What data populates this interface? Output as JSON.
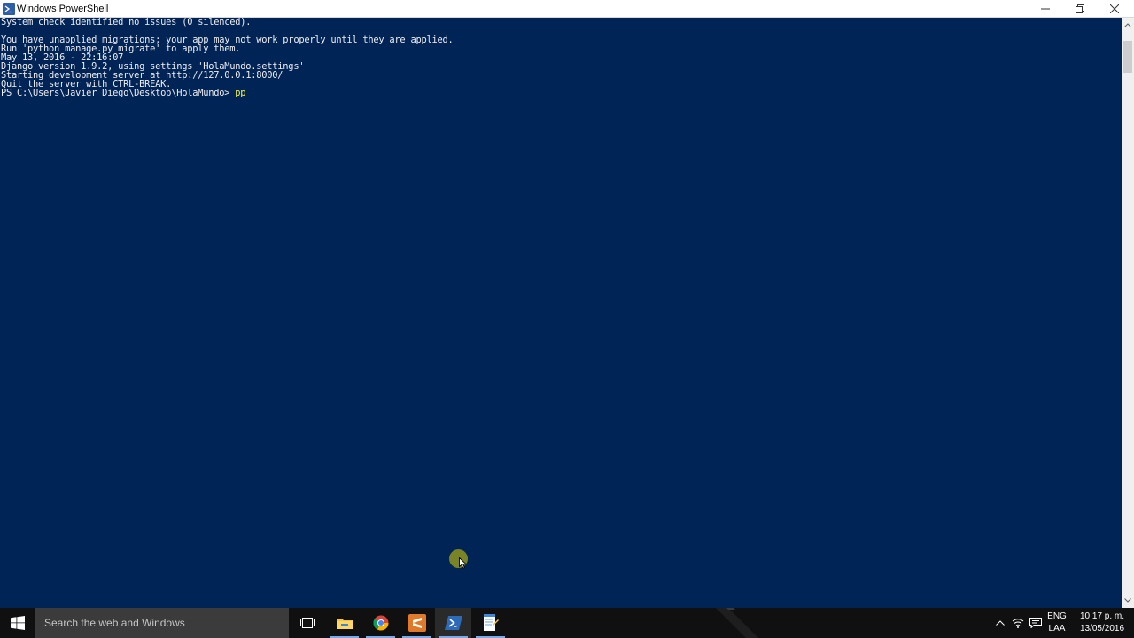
{
  "window": {
    "title": "Windows PowerShell",
    "icon": "powershell-icon",
    "controls": [
      "minimize-icon",
      "restore-icon",
      "close-icon"
    ]
  },
  "console": {
    "lines": [
      "System check identified no issues (0 silenced).",
      "",
      "You have unapplied migrations; your app may not work properly until they are applied.",
      "Run 'python manage.py migrate' to apply them.",
      "May 13, 2016 - 22:16:07",
      "Django version 1.9.2, using settings 'HolaMundo.settings'",
      "Starting development server at http://127.0.0.1:8000/",
      "Quit the server with CTRL-BREAK."
    ],
    "prompt": "PS C:\\Users\\Javier Diego\\Desktop\\HolaMundo> ",
    "typed_command": "pp",
    "colors": {
      "background": "#012456",
      "text": "#eeedf0",
      "typed": "#f5f545"
    }
  },
  "taskbar": {
    "search_placeholder": "Search the web and Windows",
    "apps": [
      {
        "name": "task-view-icon",
        "active": false
      },
      {
        "name": "file-explorer-icon",
        "active": false
      },
      {
        "name": "chrome-icon",
        "active": false
      },
      {
        "name": "sublime-text-icon",
        "active": false
      },
      {
        "name": "powershell-icon",
        "active": true
      },
      {
        "name": "notepad-icon",
        "active": false
      }
    ],
    "tray": {
      "language_top": "ENG",
      "language_bottom": "LAA",
      "time": "10:17 p. m.",
      "date": "13/05/2016"
    }
  }
}
